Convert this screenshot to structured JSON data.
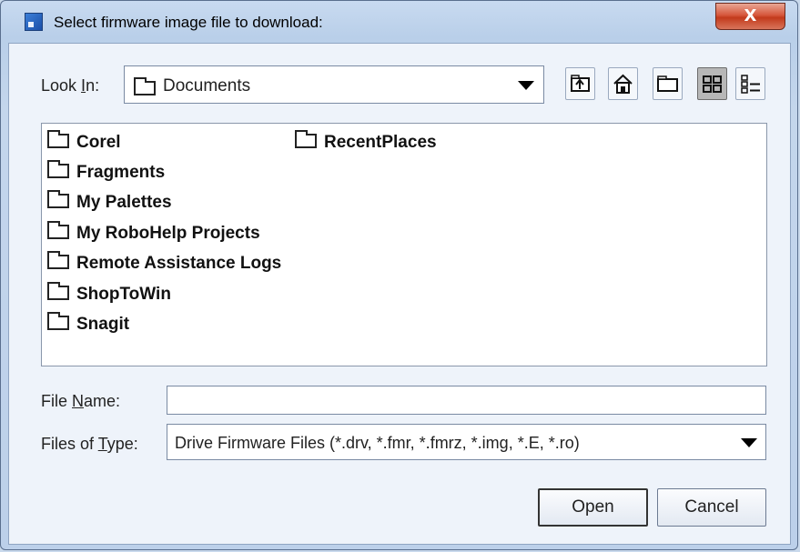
{
  "window": {
    "title": "Select firmware image file to download:",
    "close_glyph": "X"
  },
  "look_in": {
    "label_prefix": "Look ",
    "label_mnemonic": "I",
    "label_suffix": "n:",
    "value": "Documents",
    "icon": "folder-icon"
  },
  "toolbar": {
    "buttons": [
      {
        "name": "up-one-level",
        "icon": "folder-up-icon",
        "active": false
      },
      {
        "name": "home",
        "icon": "home-icon",
        "active": false
      },
      {
        "name": "new-folder",
        "icon": "new-folder-icon",
        "active": false
      },
      {
        "name": "list-view",
        "icon": "list-view-icon",
        "active": true
      },
      {
        "name": "details-view",
        "icon": "details-view-icon",
        "active": false
      }
    ]
  },
  "files": {
    "column1": [
      "Corel",
      "Fragments",
      "My Palettes",
      "My RoboHelp Projects",
      "Remote Assistance Logs",
      "ShopToWin",
      "Snagit"
    ],
    "column2": [
      "RecentPlaces"
    ]
  },
  "file_name": {
    "label_prefix": "File ",
    "label_mnemonic": "N",
    "label_suffix": "ame:",
    "value": ""
  },
  "files_of_type": {
    "label_prefix": "Files of ",
    "label_mnemonic": "T",
    "label_suffix": "ype:",
    "value": "Drive Firmware Files (*.drv, *.fmr, *.fmrz, *.img, *.E, *.ro)"
  },
  "buttons": {
    "open": "Open",
    "cancel": "Cancel"
  }
}
